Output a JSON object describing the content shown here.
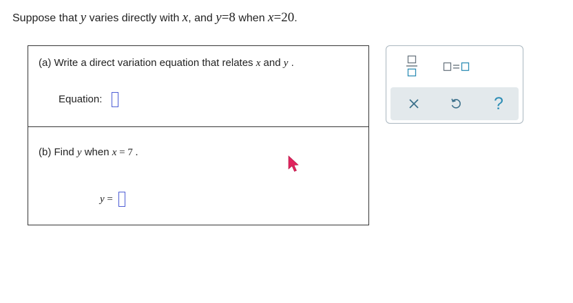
{
  "intro": {
    "t1": "Suppose that ",
    "v1": "y",
    "t2": " varies directly with ",
    "v2": "x",
    "t3": ", and ",
    "v3": "y",
    "eq1": "=8",
    "t4": " when ",
    "v4": "x",
    "eq2": "=20",
    "t5": "."
  },
  "part_a": {
    "q1": "(a) Write a direct variation equation that relates ",
    "var1": "x",
    "q2": " and ",
    "var2": "y",
    "q3": " .",
    "equation_label": "Equation:"
  },
  "part_b": {
    "q1": "(b) Find ",
    "var1": "y",
    "q2": " when ",
    "var2": "x",
    "q3": " = 7 .",
    "y_label": "y",
    "y_eq": " ="
  },
  "toolbar": {
    "help_label": "?",
    "icons": [
      "fraction-icon",
      "equals-boxes-icon",
      "clear-icon",
      "undo-icon",
      "help-icon"
    ],
    "accent_color": "#2d8db5",
    "clear_color": "#3a6f8a"
  },
  "colors": {
    "answer_box_border": "#4b5bd4",
    "cursor": "#e0245e"
  }
}
